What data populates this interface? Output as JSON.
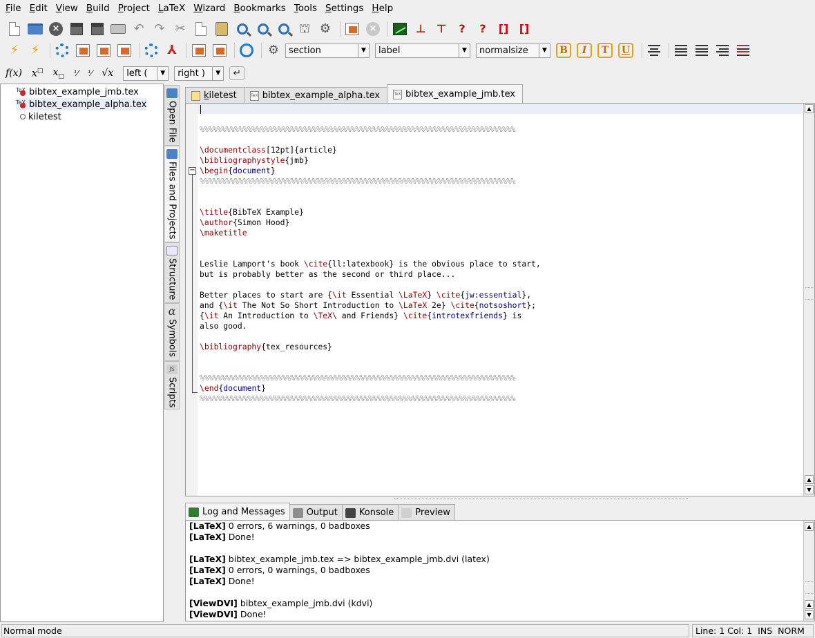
{
  "menubar": [
    {
      "label": "File",
      "ul": "F",
      "rest": "ile"
    },
    {
      "label": "Edit",
      "ul": "E",
      "rest": "dit"
    },
    {
      "label": "View",
      "ul": "V",
      "rest": "iew"
    },
    {
      "label": "Build",
      "ul": "B",
      "rest": "uild"
    },
    {
      "label": "Project",
      "ul": "P",
      "rest": "roject"
    },
    {
      "label": "LaTeX",
      "ul": "L",
      "rest": "aTeX"
    },
    {
      "label": "Wizard",
      "ul": "W",
      "rest": "izard"
    },
    {
      "label": "Bookmarks",
      "ul": "B",
      "rest": "ookmarks"
    },
    {
      "label": "Tools",
      "ul": "T",
      "rest": "ools"
    },
    {
      "label": "Settings",
      "ul": "S",
      "rest": "ettings"
    },
    {
      "label": "Help",
      "ul": "H",
      "rest": "elp"
    }
  ],
  "toolbar": {
    "section_combo": "section",
    "label_combo": "label",
    "size_combo": "normalsize",
    "left_delim": "left (",
    "right_delim": "right )",
    "bold": "B",
    "italic": "I",
    "typewriter": "T",
    "underline": "U",
    "math_fx": "f(x)"
  },
  "files_tree": [
    {
      "name": "bibtex_example_jmb.tex",
      "type": "tex"
    },
    {
      "name": "bibtex_example_alpha.tex",
      "type": "tex",
      "selected": true
    },
    {
      "name": "kiletest",
      "type": "project"
    }
  ],
  "side_tabs": [
    "Open File",
    "Files and Projects",
    "Structure",
    "Symbols",
    "Scripts"
  ],
  "editor_tabs": [
    {
      "label": "kiletest",
      "ul": "k",
      "rest": "iletest"
    },
    {
      "label": "bibtex_example_alpha.tex"
    },
    {
      "label": "bibtex_example_jmb.tex",
      "active": true
    }
  ],
  "code": {
    "comment_row": "%%%%%%%%%%%%%%%%%%%%%%%%%%%%%%%%%%%%%%%%%%%%%%%%%%%%%%%%%%%%%%%%%%%%%%%%%",
    "l_documentclass": {
      "cmd": "\\documentclass",
      "rest": "[12pt]{article}"
    },
    "l_bibstyle": {
      "cmd": "\\bibliographystyle",
      "rest": "{jmb}"
    },
    "l_begin": {
      "cmd": "\\begin",
      "rest_open": "{",
      "arg": "document",
      "rest_close": "}"
    },
    "l_title": {
      "cmd": "\\title",
      "rest": "{BibTeX Example}"
    },
    "l_author": {
      "cmd": "\\author",
      "rest": "{Simon Hood}"
    },
    "l_maketitle": {
      "cmd": "\\maketitle"
    },
    "p1a": {
      "pre": "Leslie Lamport's book ",
      "cmd": "\\cite",
      "arg": "{ll:latexbook}",
      "post": " is the obvious place to start,"
    },
    "p1b": "but is probably better as the second or third place...",
    "p2a": {
      "pre": "Better places to start are {",
      "cmd1": "\\it",
      "mid": " Essential ",
      "cmd2": "\\LaTeX",
      "mid2": "} ",
      "cmd3": "\\cite",
      "arg_open": "{",
      "arg": "jw:essential",
      "arg_close": "},"
    },
    "p2b": {
      "pre": "and {",
      "cmd1": "\\it",
      "mid": " The Not So Short Introduction to ",
      "cmd2": "\\LaTeX",
      "mid2": " 2e} ",
      "cmd3": "\\cite",
      "arg_open": "{",
      "arg": "notsoshort",
      "arg_close": "};"
    },
    "p2c": {
      "pre": "{",
      "cmd1": "\\it",
      "mid": " An Introduction to ",
      "cmd2": "\\TeX\\",
      "mid2": " and Friends} ",
      "cmd3": "\\cite",
      "arg_open": "{",
      "arg": "introtexfriends",
      "arg_close": "} is"
    },
    "p2d": "also good.",
    "l_bibliography": {
      "cmd": "\\bibliography",
      "rest": "{tex_resources}"
    },
    "l_end": {
      "cmd": "\\end",
      "rest_open": "{",
      "arg": "document",
      "rest_close": "}"
    }
  },
  "bottom_tabs": [
    {
      "label": "Log and Messages",
      "active": true
    },
    {
      "label": "Output"
    },
    {
      "label": "Konsole"
    },
    {
      "label": "Preview"
    }
  ],
  "log": [
    {
      "tag": "[LaTeX]",
      "text": " 0 errors, 6 warnings, 0 badboxes"
    },
    {
      "tag": "[LaTeX]",
      "text": " Done!"
    },
    {
      "tag": "",
      "text": ""
    },
    {
      "tag": "[LaTeX]",
      "text": " bibtex_example_jmb.tex => bibtex_example_jmb.dvi (latex)"
    },
    {
      "tag": "[LaTeX]",
      "text": " 0 errors, 0 warnings, 0 badboxes"
    },
    {
      "tag": "[LaTeX]",
      "text": " Done!"
    },
    {
      "tag": "",
      "text": ""
    },
    {
      "tag": "[ViewDVI]",
      "text": " bibtex_example_jmb.dvi (kdvi)"
    },
    {
      "tag": "[ViewDVI]",
      "text": " Done!"
    }
  ],
  "status": {
    "mode": "Normal mode",
    "position": "Line: 1 Col: 1",
    "ins": "INS",
    "norm": "NORM"
  }
}
